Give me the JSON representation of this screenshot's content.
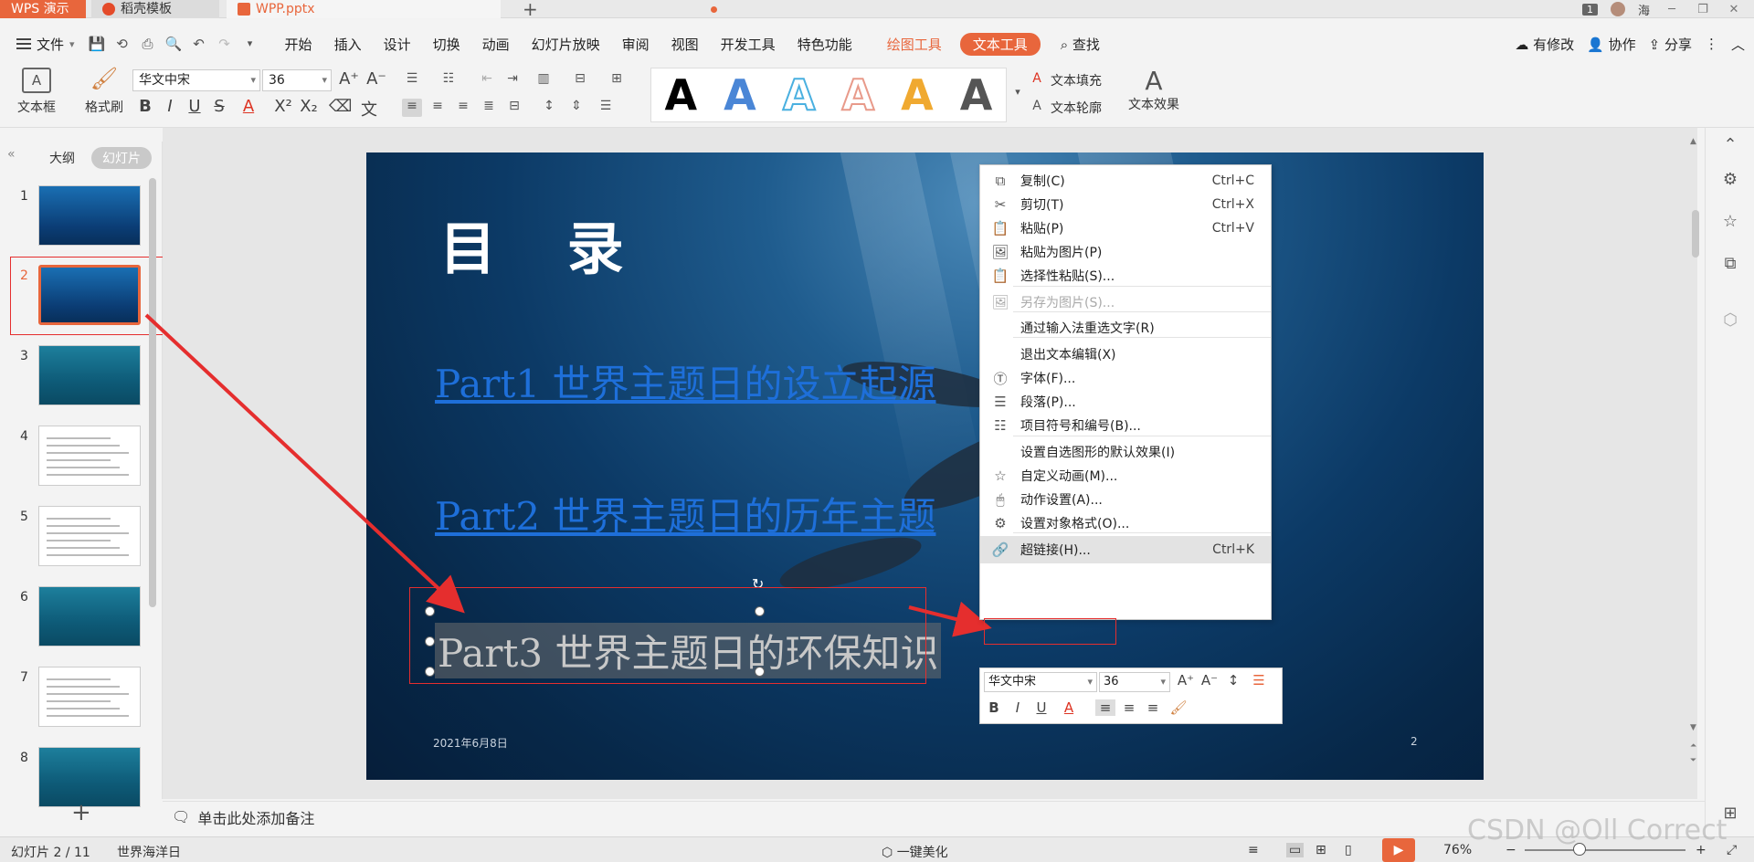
{
  "titlebar": {
    "app_name": "WPS 演示",
    "tabs": [
      {
        "label": "稻壳模板"
      },
      {
        "label": "WPP.pptx"
      }
    ],
    "badge": "1",
    "user": "海"
  },
  "menubar": {
    "file": "文件",
    "items": [
      "开始",
      "插入",
      "设计",
      "切换",
      "动画",
      "幻灯片放映",
      "审阅",
      "视图",
      "开发工具",
      "特色功能"
    ],
    "context_tabs": [
      "绘图工具",
      "文本工具"
    ],
    "search": "查找",
    "right": [
      "有修改",
      "协作",
      "分享"
    ]
  },
  "ribbon": {
    "textbox": "文本框",
    "format_painter": "格式刷",
    "font": "华文中宋",
    "size": "36",
    "wordart_glyph": "A",
    "text_fill": "文本填充",
    "text_outline": "文本轮廓",
    "text_effect": "文本效果"
  },
  "left_panel": {
    "tabs": [
      "大纲",
      "幻灯片"
    ],
    "slides": [
      "1",
      "2",
      "3",
      "4",
      "5",
      "6",
      "7",
      "8"
    ],
    "selected": "2"
  },
  "slide": {
    "title": "目 录",
    "links": [
      "Part1   世界主题日的设立起源",
      "Part2   世界主题日的历年主题"
    ],
    "selected_text": "Part3   世界主题日的环保知识",
    "date": "2021年6月8日",
    "number": "2"
  },
  "context_menu": [
    {
      "label": "复制(C)",
      "shortcut": "Ctrl+C",
      "icon": "copy-icon"
    },
    {
      "label": "剪切(T)",
      "shortcut": "Ctrl+X",
      "icon": "scissors-icon"
    },
    {
      "label": "粘贴(P)",
      "shortcut": "Ctrl+V",
      "icon": "paste-icon"
    },
    {
      "label": "粘贴为图片(P)",
      "shortcut": "",
      "icon": "paste-image-icon"
    },
    {
      "label": "选择性粘贴(S)...",
      "shortcut": "",
      "icon": "paste-special-icon"
    },
    {
      "label": "另存为图片(S)...",
      "shortcut": "",
      "icon": "save-image-icon"
    },
    {
      "label": "通过输入法重选文字(R)",
      "shortcut": "",
      "icon": ""
    },
    {
      "label": "退出文本编辑(X)",
      "shortcut": "",
      "icon": ""
    },
    {
      "label": "字体(F)...",
      "shortcut": "",
      "icon": "font-icon"
    },
    {
      "label": "段落(P)...",
      "shortcut": "",
      "icon": "paragraph-icon"
    },
    {
      "label": "项目符号和编号(B)...",
      "shortcut": "",
      "icon": "bullets-icon"
    },
    {
      "label": "设置自选图形的默认效果(I)",
      "shortcut": "",
      "icon": ""
    },
    {
      "label": "自定义动画(M)...",
      "shortcut": "",
      "icon": "star-icon"
    },
    {
      "label": "动作设置(A)...",
      "shortcut": "",
      "icon": "mouse-icon"
    },
    {
      "label": "设置对象格式(O)...",
      "shortcut": "",
      "icon": "format-icon"
    },
    {
      "label": "超链接(H)...",
      "shortcut": "Ctrl+K",
      "icon": "link-icon"
    }
  ],
  "mini_toolbar": {
    "font": "华文中宋",
    "size": "36"
  },
  "notes": {
    "placeholder": "单击此处添加备注"
  },
  "status": {
    "slide_info": "幻灯片 2 / 11",
    "theme": "世界海洋日",
    "beautify": "一键美化",
    "zoom": "76%"
  },
  "watermark": "CSDN @Oll Correct",
  "colors": {
    "accent": "#e8663c",
    "annotation": "#e52e2e",
    "link": "#1e6fd9"
  }
}
